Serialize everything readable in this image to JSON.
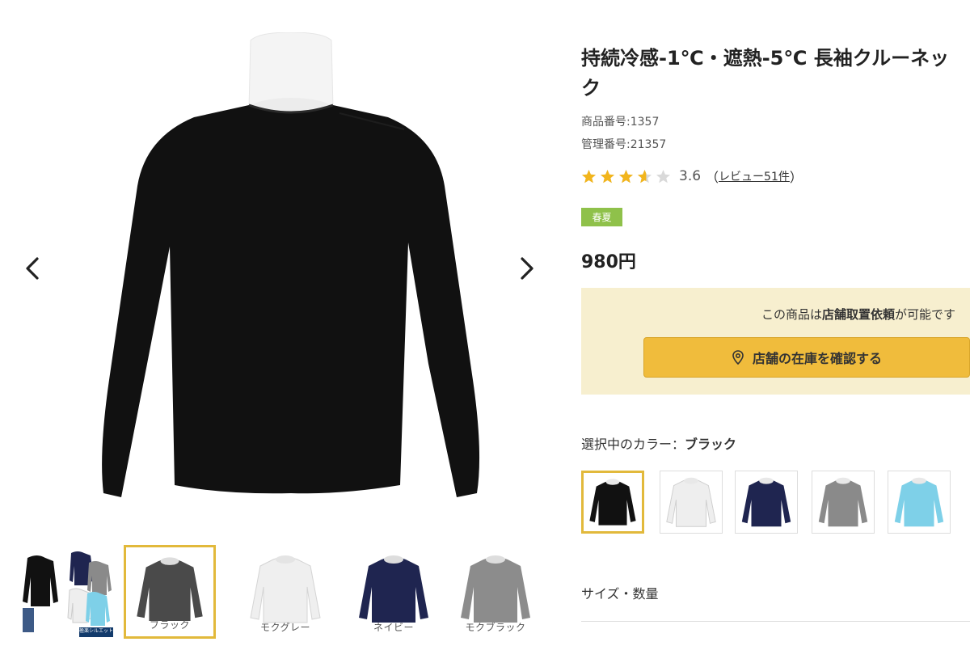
{
  "gallery": {
    "prev_icon": "chevron-left-icon",
    "next_icon": "chevron-right-icon",
    "thumbnails": [
      {
        "label": "",
        "variant": "collage"
      },
      {
        "label": "ブラック",
        "color": "#4a4a4a",
        "active": true
      },
      {
        "label": "モクグレー",
        "color": "#efefef"
      },
      {
        "label": "ネイビー",
        "color": "#1f2550"
      },
      {
        "label": "モクブラック",
        "color": "#8c8c8c"
      }
    ],
    "collage_badge": "極楽シルエット"
  },
  "product": {
    "title": "持続冷感-1℃・遮熱-5℃ 長袖クルーネック",
    "product_code": "商品番号:1357",
    "management_code": "管理番号:21357",
    "rating": {
      "value": 3.6,
      "score_text": "3.6",
      "paren_open": "（",
      "review_link": "レビュー51件",
      "paren_close": "）",
      "star_color": "#f2b51c",
      "empty_star_color": "#d9d9d9"
    },
    "season_tag": "春夏",
    "season_tag_color": "#8fc14a",
    "price": "980円"
  },
  "store": {
    "note_prefix": "この商品は",
    "note_bold": "店舗取置依頼",
    "note_suffix": "が可能です",
    "button_label": "店舗の在庫を確認する",
    "button_color": "#f0bc3c",
    "button_icon": "map-pin-icon"
  },
  "color_selection": {
    "label_prefix": "選択中のカラー：",
    "selected": "ブラック",
    "swatches": [
      {
        "name": "ブラック",
        "color": "#111111",
        "active": true
      },
      {
        "name": "ホワイト",
        "color": "#eeeeee"
      },
      {
        "name": "ネイビー",
        "color": "#1f2550"
      },
      {
        "name": "グレー",
        "color": "#8a8a8a"
      },
      {
        "name": "サックス",
        "color": "#7ed0e8"
      }
    ]
  },
  "size_section": {
    "label": "サイズ・数量"
  },
  "colors": {
    "accent": "#e2b93b",
    "shirt_main": "#111111"
  }
}
